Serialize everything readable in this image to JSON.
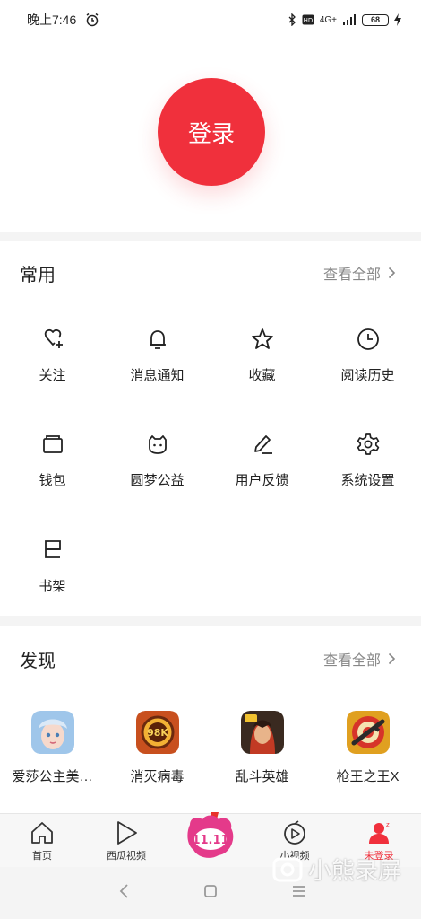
{
  "status_bar": {
    "time": "晚上7:46",
    "network": "4G+",
    "battery": "68"
  },
  "login": {
    "label": "登录"
  },
  "common": {
    "title": "常用",
    "more": "查看全部",
    "items": [
      {
        "label": "关注",
        "icon": "heart-plus-icon"
      },
      {
        "label": "消息通知",
        "icon": "bell-icon"
      },
      {
        "label": "收藏",
        "icon": "star-icon"
      },
      {
        "label": "阅读历史",
        "icon": "clock-icon"
      },
      {
        "label": "钱包",
        "icon": "wallet-icon"
      },
      {
        "label": "圆梦公益",
        "icon": "charity-face-icon"
      },
      {
        "label": "用户反馈",
        "icon": "pen-icon"
      },
      {
        "label": "系统设置",
        "icon": "gear-icon"
      },
      {
        "label": "书架",
        "icon": "bookshelf-icon"
      }
    ]
  },
  "discover": {
    "title": "发现",
    "more": "查看全部",
    "games": [
      {
        "label": "爱莎公主美…",
        "color": "#9fc6ea"
      },
      {
        "label": "消灭病毒",
        "color": "#c8501e"
      },
      {
        "label": "乱斗英雄",
        "color": "#8b2d22"
      },
      {
        "label": "枪王之王X",
        "color": "#e0a020"
      }
    ]
  },
  "bottom_nav": {
    "items": [
      {
        "label": "首页",
        "icon": "home-icon"
      },
      {
        "label": "西瓜视频",
        "icon": "play-icon"
      },
      {
        "label": "",
        "icon": "double-eleven-icon"
      },
      {
        "label": "小视频",
        "icon": "short-video-icon"
      },
      {
        "label": "未登录",
        "icon": "user-icon"
      }
    ]
  },
  "watermark": {
    "text": "小熊录屏"
  },
  "colors": {
    "accent": "#f0303c",
    "text": "#222222",
    "muted": "#888888"
  }
}
